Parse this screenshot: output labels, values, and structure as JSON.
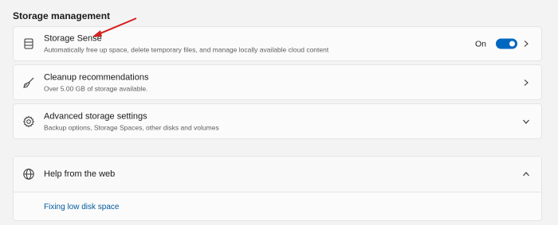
{
  "section": {
    "title": "Storage management"
  },
  "storage_sense": {
    "title": "Storage Sense",
    "subtitle": "Automatically free up space, delete temporary files, and manage locally available cloud content",
    "toggle_label": "On",
    "toggle_on": true
  },
  "cleanup": {
    "title": "Cleanup recommendations",
    "subtitle": "Over 5.00 GB of storage available."
  },
  "advanced": {
    "title": "Advanced storage settings",
    "subtitle": "Backup options, Storage Spaces, other disks and volumes"
  },
  "help": {
    "title": "Help from the web",
    "link": "Fixing low disk space"
  },
  "icons": {
    "storage_sense": "storage-drive-icon",
    "cleanup": "broom-icon",
    "advanced": "gear-icon",
    "help": "globe-icon"
  },
  "colors": {
    "accent": "#0067c0",
    "link": "#005a9e",
    "annotation_arrow": "#d42020"
  }
}
